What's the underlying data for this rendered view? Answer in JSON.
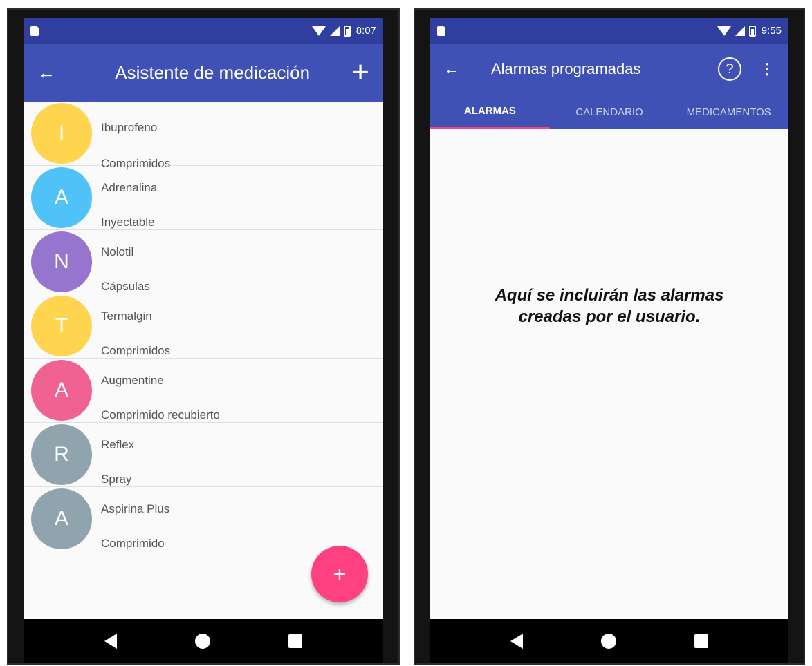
{
  "screen_left": {
    "status": {
      "time": "8:07"
    },
    "appbar": {
      "back": "←",
      "title": "Asistente de medicación",
      "add": "+"
    },
    "medications": [
      {
        "initial": "I",
        "name": "Ibuprofeno",
        "form": "Comprimidos",
        "color": "#ffd54f"
      },
      {
        "initial": "A",
        "name": "Adrenalina",
        "form": "Inyectable",
        "color": "#4fc3f7"
      },
      {
        "initial": "N",
        "name": "Nolotil",
        "form": "Cápsulas",
        "color": "#9575cd"
      },
      {
        "initial": "T",
        "name": "Termalgin",
        "form": "Comprimidos",
        "color": "#ffd54f"
      },
      {
        "initial": "A",
        "name": "Augmentine",
        "form": "Comprimido recubierto",
        "color": "#f06292"
      },
      {
        "initial": "R",
        "name": "Reflex",
        "form": "Spray",
        "color": "#90a4ae"
      },
      {
        "initial": "A",
        "name": "Aspirina Plus",
        "form": "Comprimido",
        "color": "#90a4ae"
      }
    ],
    "fab": "+"
  },
  "screen_right": {
    "status": {
      "time": "9:55"
    },
    "appbar": {
      "back": "←",
      "title": "Alarmas programadas",
      "help": "?",
      "more": "⋮"
    },
    "tabs": [
      {
        "label": "ALARMAS",
        "active": true
      },
      {
        "label": "CALENDARIO",
        "active": false
      },
      {
        "label": "MEDICAMENTOS",
        "active": false
      }
    ],
    "empty_line1": "Aquí se incluirán las alarmas",
    "empty_line2": "creadas por el usuario."
  },
  "colors": {
    "primary": "#3f51b5",
    "primary_dark": "#303f9f",
    "accent": "#ff4081"
  }
}
